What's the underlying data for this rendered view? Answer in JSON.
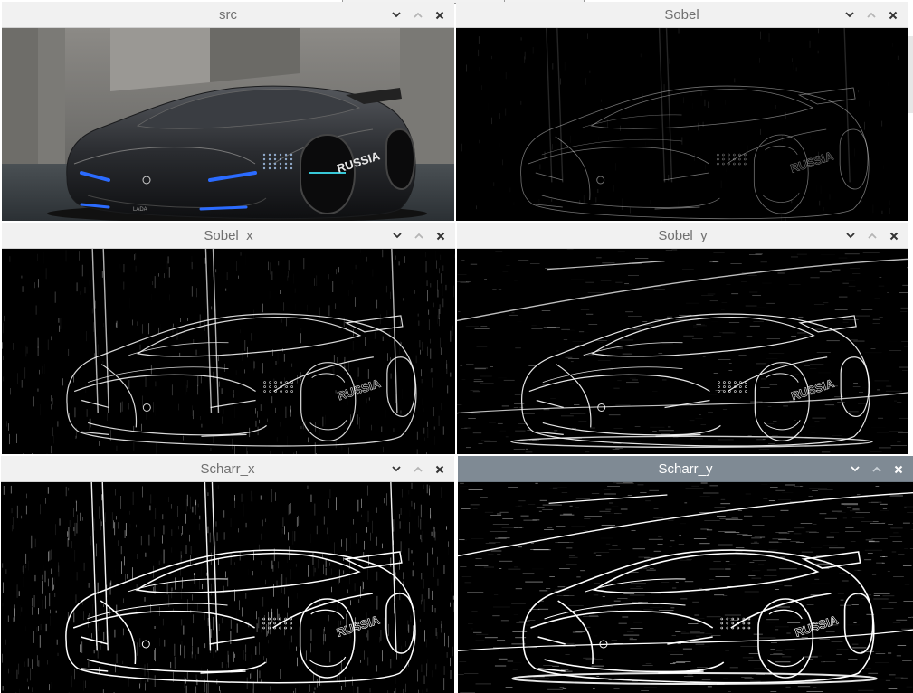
{
  "desktop": {
    "windows": [
      {
        "id": "src",
        "title": "src",
        "style": "photo",
        "active": false
      },
      {
        "id": "sobel",
        "title": "Sobel",
        "style": "sobel",
        "active": false
      },
      {
        "id": "sobel_x",
        "title": "Sobel_x",
        "style": "edge_x",
        "active": false
      },
      {
        "id": "sobel_y",
        "title": "Sobel_y",
        "style": "edge_y",
        "active": false
      },
      {
        "id": "scharr_x",
        "title": "Scharr_x",
        "style": "edge_x_strong",
        "active": false
      },
      {
        "id": "scharr_y",
        "title": "Scharr_y",
        "style": "edge_y_strong",
        "active": true
      }
    ],
    "controls": {
      "minimize_icon": "chevron-down-icon",
      "maximize_icon": "chevron-up-icon",
      "close_icon": "close-icon"
    },
    "image_text": {
      "brand": "RUSSIA",
      "badge": "LADA"
    },
    "colors": {
      "titlebar": "#f1f1f1",
      "titlebar_active": "#7f8a94",
      "headlight": "#2b6bff",
      "edge": "#ffffff"
    }
  }
}
